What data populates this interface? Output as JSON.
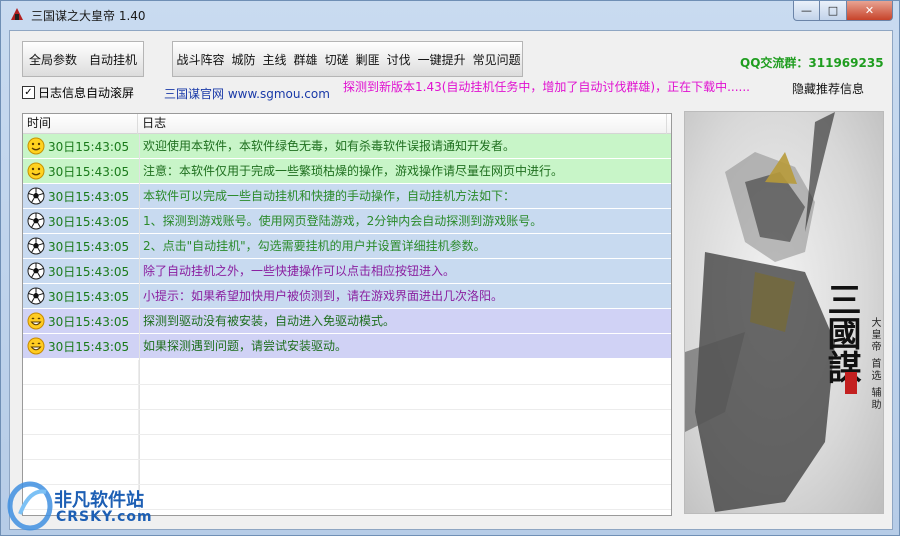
{
  "window": {
    "title": "三国谋之大皇帝 1.40",
    "controls": {
      "minimize": "—",
      "maximize": "□",
      "close": "✕"
    }
  },
  "toolbar_left": [
    {
      "label": "全局参数"
    },
    {
      "label": "自动挂机"
    }
  ],
  "toolbar_right": [
    {
      "label": "战斗阵容"
    },
    {
      "label": "城防"
    },
    {
      "label": "主线"
    },
    {
      "label": "群雄"
    },
    {
      "label": "切磋"
    },
    {
      "label": "剿匪"
    },
    {
      "label": "讨伐"
    },
    {
      "label": "一键提升"
    },
    {
      "label": "常见问题"
    }
  ],
  "qq_group": "QQ交流群：311969235",
  "auto_scroll": {
    "label": "日志信息自动滚屏",
    "checked": true,
    "mark": "✓"
  },
  "official_site": "三国谋官网 www.sgmou.com",
  "update_notice": "探测到新版本1.43(自动挂机任务中，增加了自动讨伐群雄)，正在下载中......",
  "hide_recommend": "隐藏推荐信息",
  "log": {
    "headers": {
      "time": "时间",
      "log": "日志"
    },
    "rows": [
      {
        "icon": "smile-face-icon",
        "time": "30日15:43:05",
        "text": "欢迎使用本软件，本软件绿色无毒，如有杀毒软件误报请通知开发者。"
      },
      {
        "icon": "smile-face-icon",
        "time": "30日15:43:05",
        "text": "注意：本软件仅用于完成一些繁琐枯燥的操作，游戏操作请尽量在网页中进行。"
      },
      {
        "icon": "soccer-ball-icon",
        "time": "30日15:43:05",
        "text": "本软件可以完成一些自动挂机和快捷的手动操作，自动挂机方法如下："
      },
      {
        "icon": "soccer-ball-icon",
        "time": "30日15:43:05",
        "text": "1、探测到游戏账号。使用网页登陆游戏，2分钟内会自动探测到游戏账号。"
      },
      {
        "icon": "soccer-ball-icon",
        "time": "30日15:43:05",
        "text": "2、点击\"自动挂机\"，勾选需要挂机的用户并设置详细挂机参数。"
      },
      {
        "icon": "soccer-ball-icon",
        "time": "30日15:43:05",
        "text": "除了自动挂机之外，一些快捷操作可以点击相应按钮进入。"
      },
      {
        "icon": "soccer-ball-icon",
        "time": "30日15:43:05",
        "text": "小提示：如果希望加快用户被侦测到，请在游戏界面进出几次洛阳。"
      },
      {
        "icon": "grin-face-icon",
        "time": "30日15:43:05",
        "text": "探测到驱动没有被安装，自动进入免驱动模式。"
      },
      {
        "icon": "grin-face-icon",
        "time": "30日15:43:05",
        "text": "如果探测遇到问题，请尝试安装驱动。"
      }
    ]
  },
  "banner": {
    "title": "三國謀",
    "subtitle": "大皇帝 首选 辅助"
  },
  "watermark": {
    "cn": "非凡软件站",
    "en": "CRSKY.com"
  }
}
